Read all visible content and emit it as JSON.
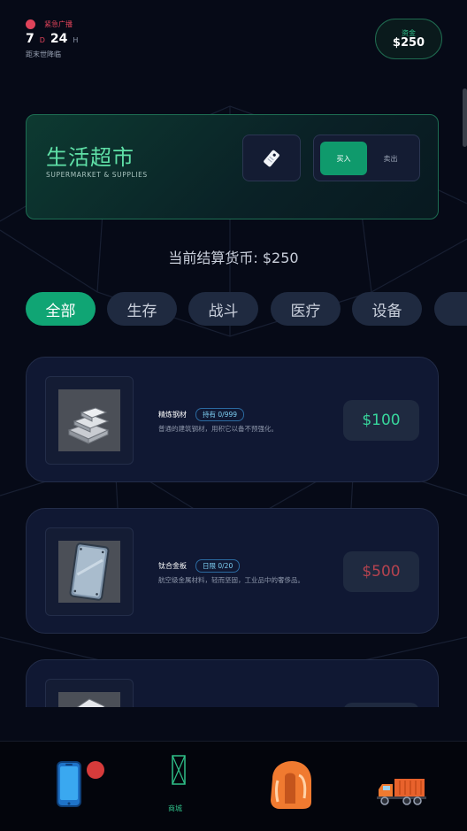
{
  "header": {
    "alert_label": "紧急广播",
    "days": "7",
    "days_unit": "D",
    "hours": "24",
    "hours_unit": "H",
    "countdown_caption": "距末世降临",
    "funds_label": "资金",
    "funds_value": "$250"
  },
  "shop": {
    "title": "生活超市",
    "subtitle": "SUPERMARKET & SUPPLIES",
    "tag_icon": "price-tag-icon",
    "mode_buy": "买入",
    "mode_sell": "卖出",
    "active_mode": "buy"
  },
  "currency_line": "当前结算货币: $250",
  "tabs": [
    {
      "label": "全部",
      "active": true
    },
    {
      "label": "生存",
      "active": false
    },
    {
      "label": "战斗",
      "active": false
    },
    {
      "label": "医疗",
      "active": false
    },
    {
      "label": "设备",
      "active": false
    }
  ],
  "items": [
    {
      "name": "精炼钢材",
      "badge": "持有 0/999",
      "description": "普通的建筑钢材，用积它以备不预强化。",
      "price": "$100",
      "affordable": true,
      "icon": "steel-ingots-icon"
    },
    {
      "name": "钛合金板",
      "badge": "日限 0/20",
      "description": "航空级金属材料，轻而坚固，工业品中的奢侈品。",
      "price": "$500",
      "affordable": false,
      "icon": "titanium-plate-icon"
    }
  ],
  "nav": {
    "phone_icon": "phone-icon",
    "shop_label": "商城",
    "backpack_icon": "backpack-icon",
    "truck_icon": "truck-icon"
  },
  "colors": {
    "accent": "#10a574",
    "danger": "#e0435a",
    "background": "#060a17"
  }
}
